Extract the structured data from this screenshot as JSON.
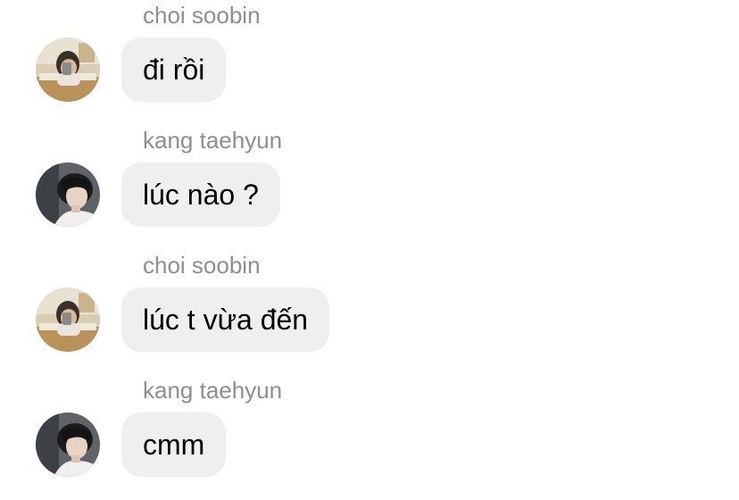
{
  "messages": [
    {
      "sender": "choi soobin",
      "text": "đi rồi",
      "avatar": "soobin-avatar"
    },
    {
      "sender": "kang taehyun",
      "text": "lúc nào ?",
      "avatar": "taehyun-avatar"
    },
    {
      "sender": "choi soobin",
      "text": "lúc t vừa đến",
      "avatar": "soobin-avatar"
    },
    {
      "sender": "kang taehyun",
      "text": "cmm",
      "avatar": "taehyun-avatar"
    }
  ],
  "colors": {
    "bubble": "#efefef",
    "sender": "#8e8e93",
    "text": "#000000",
    "background": "#ffffff"
  }
}
